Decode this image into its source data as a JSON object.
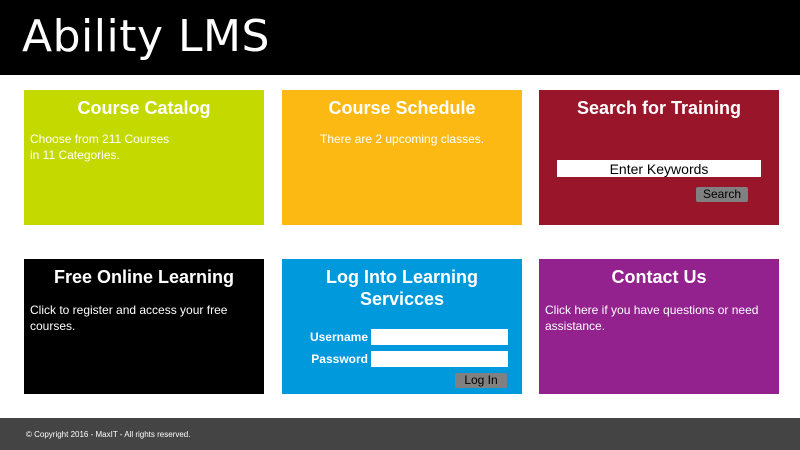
{
  "header": {
    "title": "Ability LMS"
  },
  "tiles": {
    "catalog": {
      "title": "Course Catalog",
      "line1": "Choose from 211 Courses",
      "line2": "in 11 Categories.",
      "color": "#c3d900"
    },
    "schedule": {
      "title": "Course Schedule",
      "text": "There are 2 upcoming classes.",
      "color": "#fdb913"
    },
    "search": {
      "title": "Search for Training",
      "placeholder": "Enter Keywords",
      "button_label": "Search",
      "color": "#99162a"
    },
    "free": {
      "title": "Free Online Learning",
      "text": "Click to register and access your free courses.",
      "color": "#000000"
    },
    "login": {
      "title": "Log Into Learning Servicces",
      "username_label": "Username",
      "password_label": "Password",
      "button_label": "Log In",
      "color": "#0099db"
    },
    "contact": {
      "title": "Contact Us",
      "text": "Click here if you have questions or need assistance.",
      "color": "#93228f"
    }
  },
  "footer": {
    "copyright": "© Copyright 2016 - MaxIT - All rights reserved."
  }
}
